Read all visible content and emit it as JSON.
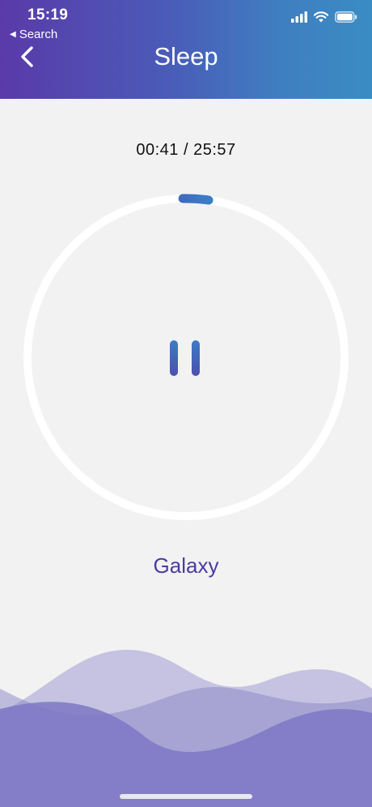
{
  "status_bar": {
    "time": "15:19",
    "back_app": "Search",
    "back_arrow": "◀"
  },
  "header": {
    "title": "Sleep"
  },
  "player": {
    "elapsed": "00:41",
    "total": "25:57",
    "timer_text": "00:41 / 25:57",
    "progress_fraction": 0.026,
    "state": "playing",
    "track_name": "Galaxy"
  },
  "icons": {
    "back": "chevron-left-icon",
    "signal": "cellular-signal-icon",
    "wifi": "wifi-icon",
    "battery": "battery-icon",
    "pause": "pause-icon"
  },
  "colors": {
    "header_start": "#5a3aa8",
    "header_end": "#3a8cc4",
    "accent_blue": "#3d74c4",
    "track_name": "#4b3ca0",
    "wave_base": "#7d78c4",
    "background": "#f2f2f2"
  }
}
